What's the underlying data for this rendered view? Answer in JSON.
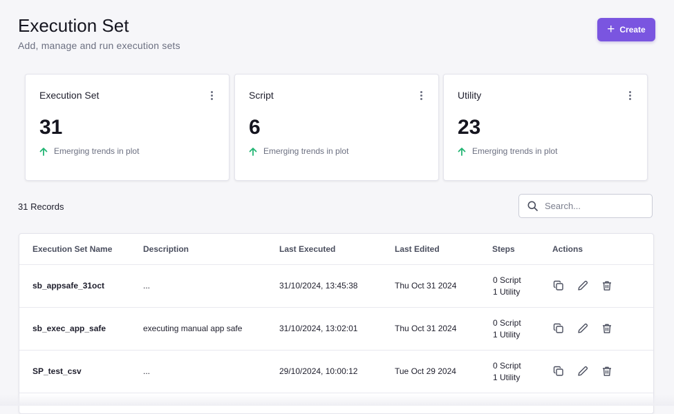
{
  "header": {
    "title": "Execution Set",
    "subtitle": "Add, manage and run execution sets",
    "create_label": "Create"
  },
  "cards": [
    {
      "title": "Execution Set",
      "value": "31",
      "trend": "Emerging trends in plot"
    },
    {
      "title": "Script",
      "value": "6",
      "trend": "Emerging trends in plot"
    },
    {
      "title": "Utility",
      "value": "23",
      "trend": "Emerging trends in plot"
    }
  ],
  "records_label": "31 Records",
  "search": {
    "placeholder": "Search...",
    "value": ""
  },
  "table": {
    "columns": [
      "Execution Set Name",
      "Description",
      "Last Executed",
      "Last Edited",
      "Steps",
      "Actions"
    ],
    "rows": [
      {
        "name": "sb_appsafe_31oct",
        "description": "...",
        "last_executed": "31/10/2024, 13:45:38",
        "last_edited": "Thu Oct 31 2024",
        "steps_script": "0 Script",
        "steps_utility": "1 Utility"
      },
      {
        "name": "sb_exec_app_safe",
        "description": "executing manual app safe",
        "last_executed": "31/10/2024, 13:02:01",
        "last_edited": "Thu Oct 31 2024",
        "steps_script": "0 Script",
        "steps_utility": "1 Utility"
      },
      {
        "name": "SP_test_csv",
        "description": "...",
        "last_executed": "29/10/2024, 10:00:12",
        "last_edited": "Tue Oct 29 2024",
        "steps_script": "0 Script",
        "steps_utility": "1 Utility"
      }
    ]
  },
  "colors": {
    "accent": "#7a55e0",
    "trend_up": "#22b573"
  },
  "icons": {
    "create": "plus-icon",
    "card_menu": "more-vertical-icon",
    "trend": "arrow-up-icon",
    "search": "search-icon",
    "copy": "copy-icon",
    "edit": "pencil-icon",
    "delete": "trash-icon"
  }
}
